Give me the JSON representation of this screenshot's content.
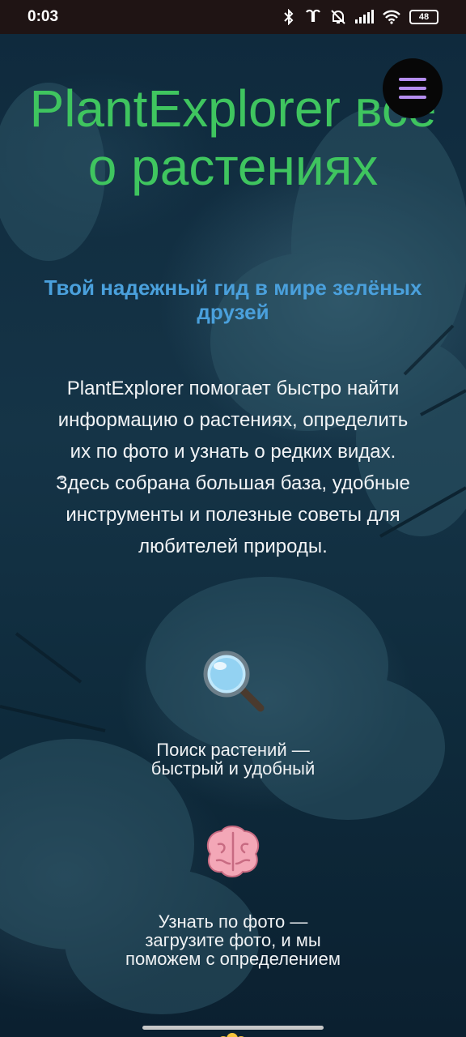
{
  "status_bar": {
    "time": "0:03",
    "battery": "48",
    "icons": [
      "bluetooth-icon",
      "earbuds-icon",
      "bell-off-icon",
      "signal-icon",
      "wifi-icon",
      "battery-icon"
    ]
  },
  "menu": {
    "icon": "hamburger-menu-icon",
    "color": "#b58ef0"
  },
  "hero": {
    "title": "PlantExplorer всё о растениях",
    "tagline": "Твой надежный гид в мире зелёных друзей",
    "description": "PlantExplorer помогает быстро найти информацию о растениях, определить их по фото и узнать о редких видах. Здесь собрана большая база, удобные инструменты и полезные советы для любителей природы."
  },
  "features": [
    {
      "icon": "magnifying-glass-icon",
      "text": "Поиск растений — быстрый и удобный"
    },
    {
      "icon": "brain-icon",
      "text": "Узнать по фото — загрузите фото, и мы поможем с определением"
    },
    {
      "icon": "flower-icon",
      "text": ""
    }
  ],
  "colors": {
    "title": "#3fc55f",
    "tagline": "#4aa0dc",
    "background": "#0f2a3d"
  }
}
